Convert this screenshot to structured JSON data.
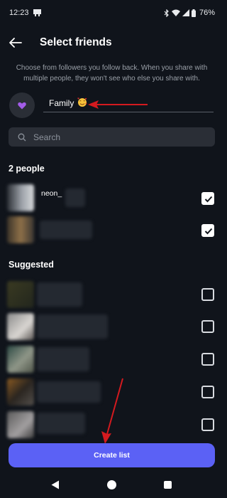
{
  "status_bar": {
    "time": "12:23",
    "battery": "76%"
  },
  "header": {
    "title": "Select friends"
  },
  "description": "Choose from followers you follow back. When you share with multiple people, they won't see who else you share with.",
  "list_name": {
    "value": "Family",
    "emoji": "smiling-face-with-hearts",
    "avatar_emoji": "purple-heart"
  },
  "search": {
    "placeholder": "Search"
  },
  "selected_section": {
    "title": "2 people",
    "friends": [
      {
        "name": "neon_",
        "checked": true
      },
      {
        "name": "",
        "checked": true
      }
    ]
  },
  "suggested_section": {
    "title": "Suggested",
    "friends": [
      {
        "name": "",
        "checked": false
      },
      {
        "name": "",
        "checked": false
      },
      {
        "name": "",
        "checked": false
      },
      {
        "name": "",
        "checked": false
      },
      {
        "name": "",
        "checked": false
      }
    ]
  },
  "create_button": {
    "label": "Create list"
  },
  "colors": {
    "background": "#10141b",
    "accent": "#5b61f5",
    "annotation": "#d41a1f"
  }
}
